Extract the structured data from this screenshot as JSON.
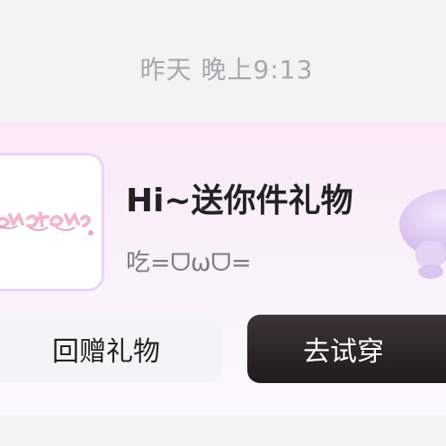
{
  "chat": {
    "timestamp": "昨天 晚上9:13"
  },
  "gift_card": {
    "title": "Hi~送你件礼物",
    "subtitle": "吃=ᗜωᗜ=",
    "return_gift_label": "回赠礼物",
    "try_on_label": "去试穿",
    "colors": {
      "card_top": "#fbe9f8",
      "card_bottom": "#fbfafc",
      "thumb_border": "#ecd2f7",
      "try_on_bg": "#2b2426",
      "return_bg": "#f4f4f6"
    },
    "icons": {
      "thumbnail": "gift-sticker-image",
      "decoration": "purple-mushroom-decoration"
    }
  }
}
